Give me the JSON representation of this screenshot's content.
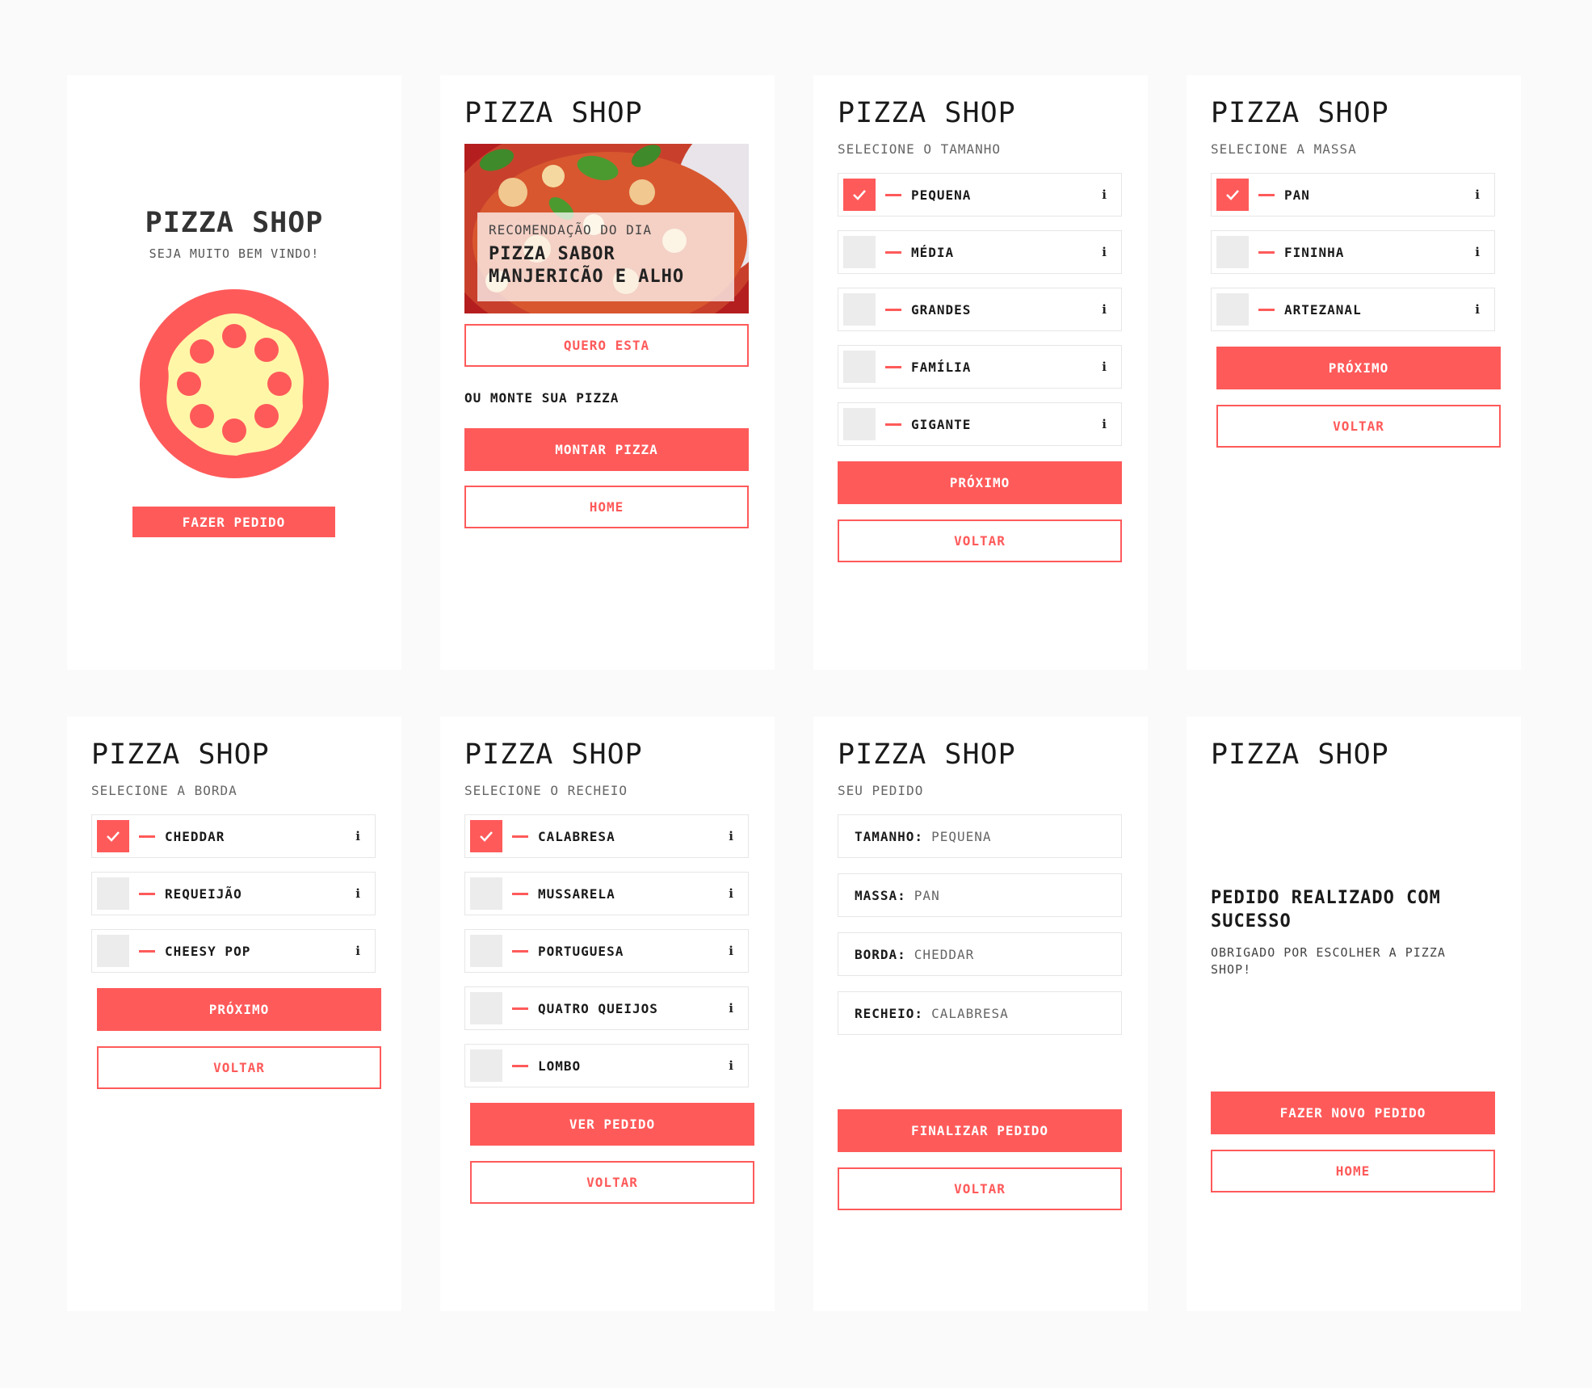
{
  "brand": {
    "name": "PIZZA SHOP",
    "accent": "#ff5a5a",
    "cream": "#fff6a8"
  },
  "welcome": {
    "title": "PIZZA SHOP",
    "subtitle": "SEJA MUITO BEM VINDO!",
    "button": "FAZER PEDIDO"
  },
  "home": {
    "title": "PIZZA SHOP",
    "recommendation_kicker": "RECOMENDAÇÃO DO DIA",
    "recommendation_name": "PIZZA SABOR MANJERICÃO E ALHO",
    "want_button": "QUERO ESTA",
    "build_label": "OU MONTE SUA PIZZA",
    "build_button": "MONTAR PIZZA",
    "home_button": "HOME"
  },
  "size": {
    "title": "PIZZA SHOP",
    "subtitle": "SELECIONE O TAMANHO",
    "options": [
      {
        "label": "PEQUENA",
        "checked": true
      },
      {
        "label": "MÉDIA",
        "checked": false
      },
      {
        "label": "GRANDES",
        "checked": false
      },
      {
        "label": "FAMÍLIA",
        "checked": false
      },
      {
        "label": "GIGANTE",
        "checked": false
      }
    ],
    "next_button": "PRÓXIMO",
    "back_button": "VOLTAR"
  },
  "dough": {
    "title": "PIZZA SHOP",
    "subtitle": "SELECIONE A MASSA",
    "options": [
      {
        "label": "PAN",
        "checked": true
      },
      {
        "label": "FININHA",
        "checked": false
      },
      {
        "label": "ARTEZANAL",
        "checked": false
      }
    ],
    "next_button": "PRÓXIMO",
    "back_button": "VOLTAR"
  },
  "crust": {
    "title": "PIZZA SHOP",
    "subtitle": "SELECIONE A BORDA",
    "options": [
      {
        "label": "CHEDDAR",
        "checked": true
      },
      {
        "label": "REQUEIJÃO",
        "checked": false
      },
      {
        "label": "CHEESY POP",
        "checked": false
      }
    ],
    "next_button": "PRÓXIMO",
    "back_button": "VOLTAR"
  },
  "filling": {
    "title": "PIZZA SHOP",
    "subtitle": "SELECIONE O RECHEIO",
    "options": [
      {
        "label": "CALABRESA",
        "checked": true
      },
      {
        "label": "MUSSARELA",
        "checked": false
      },
      {
        "label": "PORTUGUESA",
        "checked": false
      },
      {
        "label": "QUATRO QUEIJOS",
        "checked": false
      },
      {
        "label": "LOMBO",
        "checked": false
      }
    ],
    "next_button": "VER PEDIDO",
    "back_button": "VOLTAR"
  },
  "order": {
    "title": "PIZZA SHOP",
    "subtitle": "SEU PEDIDO",
    "rows": [
      {
        "key": "TAMANHO:",
        "value": "PEQUENA"
      },
      {
        "key": "MASSA:",
        "value": "PAN"
      },
      {
        "key": "BORDA:",
        "value": "CHEDDAR"
      },
      {
        "key": "RECHEIO:",
        "value": "CALABRESA"
      }
    ],
    "finish_button": "FINALIZAR PEDIDO",
    "back_button": "VOLTAR"
  },
  "success": {
    "title": "PIZZA SHOP",
    "heading": "PEDIDO REALIZADO COM SUCESSO",
    "message": "OBRIGADO POR ESCOLHER A PIZZA SHOP!",
    "new_order_button": "FAZER NOVO PEDIDO",
    "home_button": "HOME"
  },
  "icons": {
    "check": "check-icon",
    "info": "info-icon",
    "option_marker": "dash-marker"
  }
}
